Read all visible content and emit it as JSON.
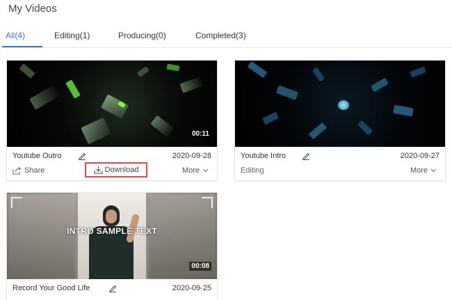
{
  "page": {
    "title": "My Videos"
  },
  "tabs": [
    {
      "label": "All(4)",
      "active": true
    },
    {
      "label": "Editing(1)",
      "active": false
    },
    {
      "label": "Producing(0)",
      "active": false
    },
    {
      "label": "Completed(3)",
      "active": false
    }
  ],
  "videos": [
    {
      "name": "Youtube Outro",
      "date": "2020-09-28",
      "duration": "00:11",
      "share_label": "Share",
      "download_label": "Download",
      "more_label": "More"
    },
    {
      "name": "Youtube Intro",
      "date": "2020-09-27",
      "status": "Editing",
      "more_label": "More"
    },
    {
      "name": "Record Your Good Life",
      "date": "2020-09-25",
      "duration": "00:08",
      "overlay_text": "INTRO SAMPLE TEXT"
    }
  ],
  "colors": {
    "accent": "#3a76d8",
    "highlight": "#e14b4b"
  },
  "icons": {
    "edit": "pencil-icon",
    "share": "share-icon",
    "download": "download-icon",
    "more": "chevron-down-icon"
  }
}
